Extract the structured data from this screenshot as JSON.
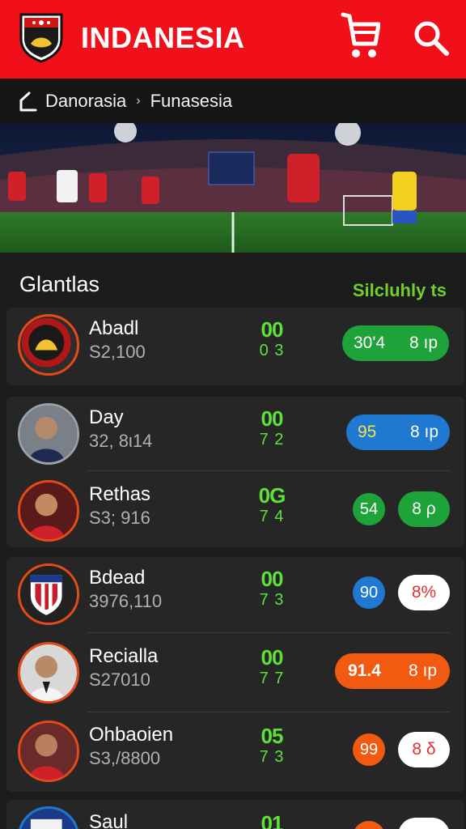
{
  "header": {
    "title": "INDANESIA",
    "logo_icon": "club-crest-icon",
    "cart_icon": "shopping-cart-icon",
    "search_icon": "search-icon",
    "bg_color": "#f1101a"
  },
  "breadcrumb": {
    "items": [
      "Danorasia",
      "Funasesia"
    ],
    "separator": "›"
  },
  "section": {
    "title": "Glantlas",
    "link": "Silcluhly ts"
  },
  "players": [
    {
      "name": "Abadl",
      "sub": "S2,100",
      "score_top": "00",
      "score_bot": "0 3",
      "badge_value": "30'4",
      "badge_unit": "8 ıp",
      "badge_color": "#1ea33a"
    },
    {
      "name": "Day",
      "sub": "32, 8ι14",
      "score_top": "00",
      "score_bot": "7 2",
      "badge_value": "95",
      "badge_unit": "8 ıp",
      "badge_color": "#1f79d1"
    },
    {
      "name": "Rethas",
      "sub": "S3; 916",
      "score_top": "0G",
      "score_bot": "7 4",
      "badge_value": "54",
      "badge_unit": "8 ρ",
      "badge_color": "#1ea33a"
    },
    {
      "name": "Bdead",
      "sub": "3976,110",
      "score_top": "00",
      "score_bot": "7 3",
      "badge_value": "90",
      "badge_unit": "8%",
      "badge_color": "#1f79d1"
    },
    {
      "name": "Recialla",
      "sub": "S27010",
      "score_top": "00",
      "score_bot": "7 7",
      "badge_value": "91.4",
      "badge_unit": "8 ıp",
      "badge_color": "#f25a12"
    },
    {
      "name": "Ohbaoien",
      "sub": "S3,/8800",
      "score_top": "05",
      "score_bot": "7 3",
      "badge_value": "99",
      "badge_unit": "8 δ",
      "badge_color": "#f25a12"
    },
    {
      "name": "Saul",
      "sub": "",
      "score_top": "01",
      "score_bot": "",
      "badge_value": "",
      "badge_unit": "",
      "badge_color": "#f25a12"
    }
  ]
}
